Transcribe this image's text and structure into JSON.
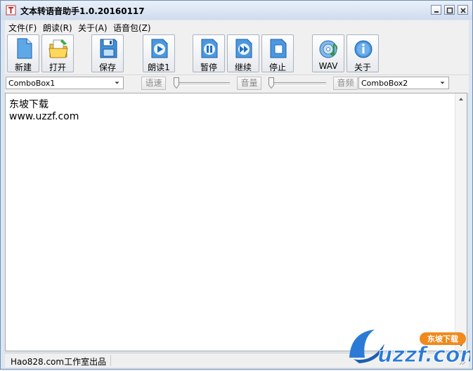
{
  "window": {
    "title": "文本转语音助手1.0.20160117"
  },
  "menu": [
    {
      "label": "文件(F)"
    },
    {
      "label": "朗读(R)"
    },
    {
      "label": "关于(A)"
    },
    {
      "label": "语音包(Z)"
    }
  ],
  "toolbar": {
    "new_label": "新建",
    "open_label": "打开",
    "save_label": "保存",
    "read_label": "朗读1",
    "pause_label": "暂停",
    "resume_label": "继续",
    "stop_label": "停止",
    "wav_label": "WAV",
    "about_label": "关于"
  },
  "options": {
    "voice_combo": "ComboBox1",
    "rate_label": "语速",
    "volume_label": "音量",
    "audio_label": "音频",
    "audio_combo": "ComboBox2"
  },
  "editor": {
    "lines": [
      "东坡下载",
      "www.uzzf.com"
    ]
  },
  "status": {
    "text": "Hao828.com工作室出品"
  },
  "watermark": {
    "brand": "uzzf.com",
    "badge": "东坡下载"
  },
  "colors": {
    "accent_blue": "#2b7bd6",
    "watermark_orange": "#f08a1c",
    "title_bar": "#dbe6f3"
  }
}
